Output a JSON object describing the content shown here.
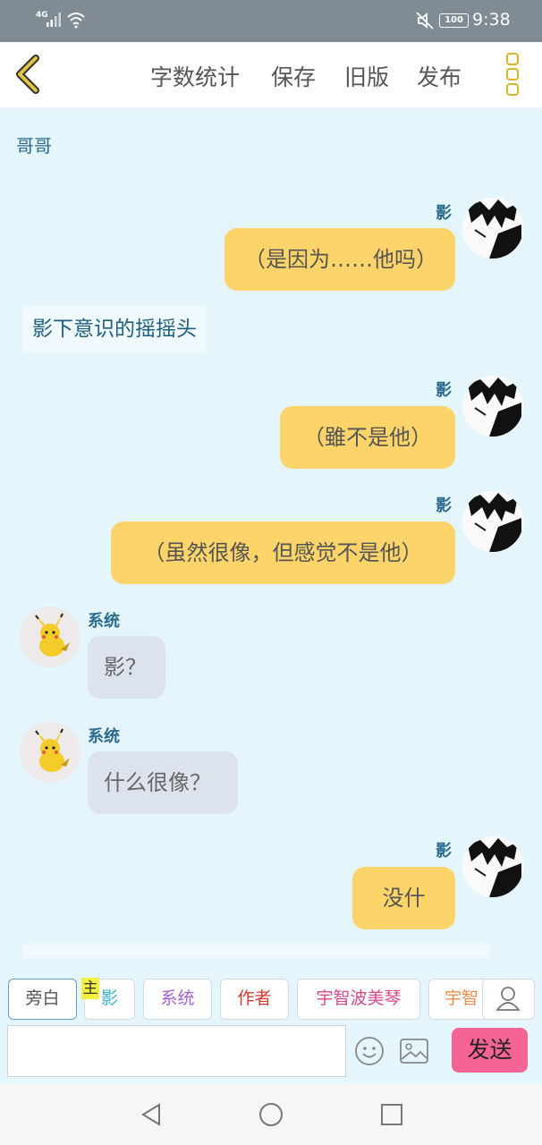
{
  "status_bar": {
    "network": "4G",
    "battery": "100",
    "time": "9:38"
  },
  "toolbar": {
    "items": [
      "字数统计",
      "保存",
      "旧版",
      "发布"
    ]
  },
  "chat": {
    "narration_1": "哥哥",
    "narration_2": "影下意识的摇摇头",
    "messages": [
      {
        "speaker": "影",
        "text": "（是因为……他吗）"
      },
      {
        "speaker": "影",
        "text": "（雖不是他）"
      },
      {
        "speaker": "影",
        "text": "（虽然很像，但感觉不是他）"
      },
      {
        "speaker": "系统",
        "text": "影？"
      },
      {
        "speaker": "系统",
        "text": "什么很像？"
      },
      {
        "speaker": "影",
        "text": "没什么"
      }
    ]
  },
  "input_panel": {
    "main_badge": "主",
    "tabs": [
      {
        "label": "旁白",
        "color": "#555555"
      },
      {
        "label": "影",
        "color": "#38b2c9"
      },
      {
        "label": "系统",
        "color": "#a45ed3"
      },
      {
        "label": "作者",
        "color": "#d9382e"
      },
      {
        "label": "宇智波美琴",
        "color": "#d9468c"
      },
      {
        "label": "宇智",
        "color": "#f08c4a"
      }
    ],
    "input_placeholder": "",
    "send_label": "发送"
  },
  "colors": {
    "status_bar": "#808b93",
    "chat_bg": "#e4f5fc",
    "self_bubble": "#fcd46a",
    "other_bubble": "#dde3ec",
    "send_button": "#f56495",
    "accent": "#d8b52c"
  }
}
